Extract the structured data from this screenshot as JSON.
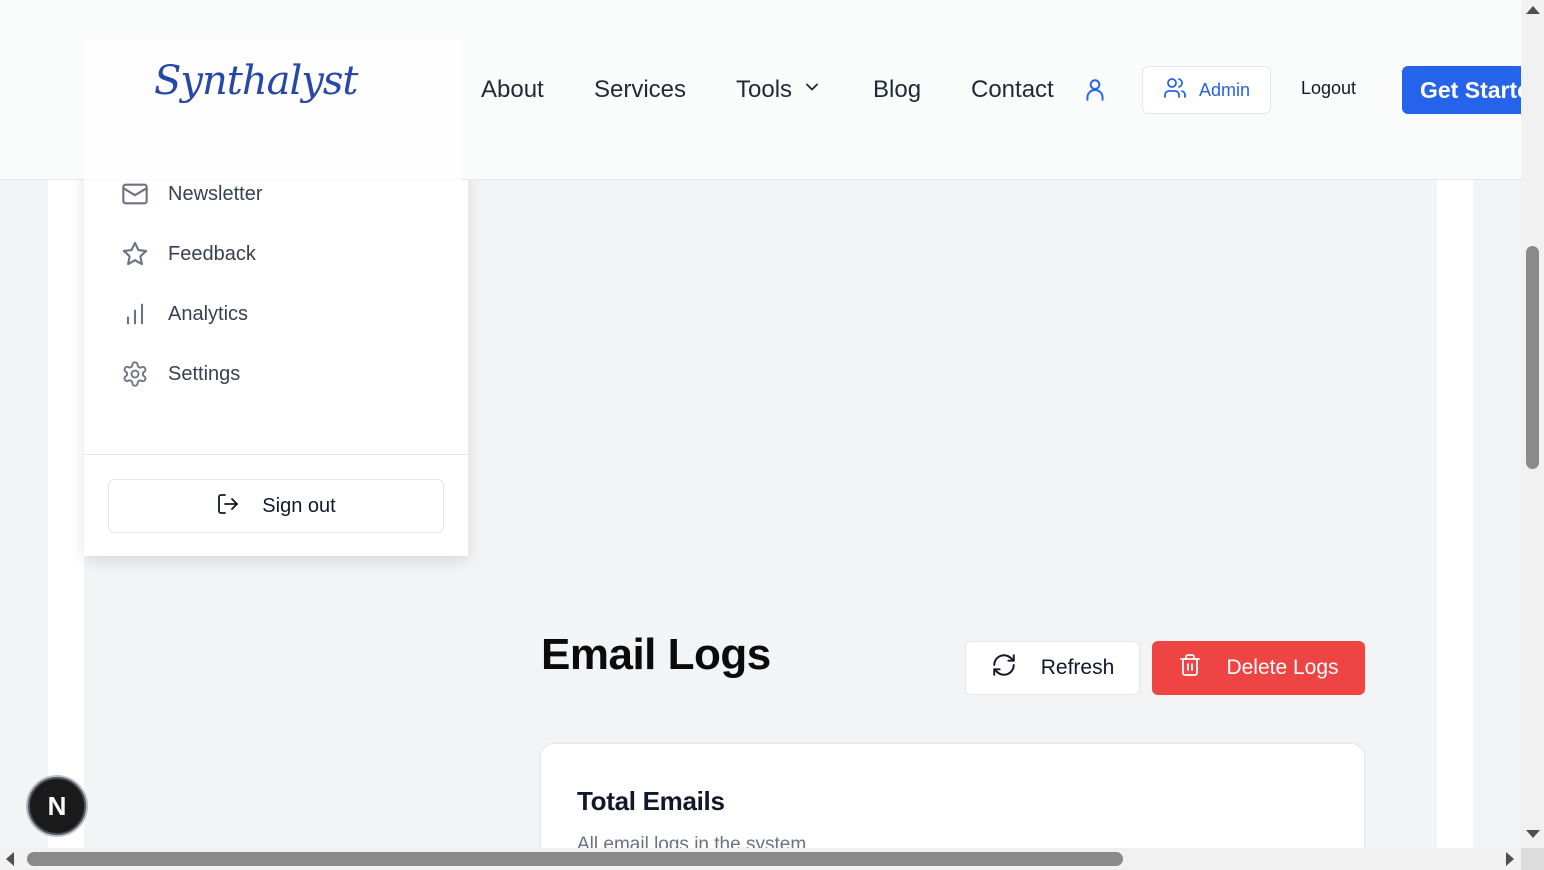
{
  "header": {
    "logo": "Synthalyst",
    "nav": {
      "about": "About",
      "services": "Services",
      "tools": "Tools",
      "blog": "Blog",
      "contact": "Contact"
    },
    "admin_label": "Admin",
    "logout_label": "Logout",
    "get_started_label": "Get Started"
  },
  "sidebar": {
    "items": [
      {
        "label": "Newsletter",
        "icon": "mail-icon"
      },
      {
        "label": "Feedback",
        "icon": "star-icon"
      },
      {
        "label": "Analytics",
        "icon": "bar-chart-icon"
      },
      {
        "label": "Settings",
        "icon": "gear-icon"
      }
    ],
    "sign_out_label": "Sign out"
  },
  "main": {
    "title": "Email Logs",
    "refresh_label": "Refresh",
    "delete_label": "Delete Logs",
    "stat_card": {
      "title": "Total Emails",
      "subtitle": "All email logs in the system"
    }
  },
  "badge": {
    "label": "N"
  },
  "colors": {
    "primary": "#2563eb",
    "danger": "#ef4444",
    "logo": "#2748a8",
    "background": "#f3f4f6"
  }
}
